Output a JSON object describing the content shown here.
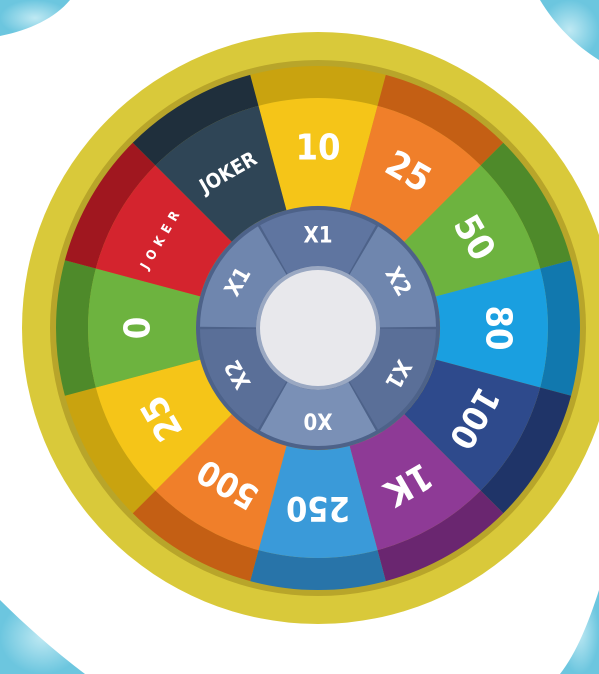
{
  "wheel": {
    "outer_segments": [
      {
        "label": "10",
        "color": "#f5c518",
        "rim": "#c9a30f"
      },
      {
        "label": "25",
        "color": "#f07f2a",
        "rim": "#c45f14"
      },
      {
        "label": "50",
        "color": "#6db33f",
        "rim": "#4e8a2a"
      },
      {
        "label": "80",
        "color": "#1a9fe0",
        "rim": "#1178ae"
      },
      {
        "label": "100",
        "color": "#2e4a8c",
        "rim": "#1f3468"
      },
      {
        "label": "1K",
        "color": "#8e3a96",
        "rim": "#6a2670"
      },
      {
        "label": "250",
        "color": "#3a9ad9",
        "rim": "#2874a9"
      },
      {
        "label": "500",
        "color": "#f07f2a",
        "rim": "#c45f14"
      },
      {
        "label": "25",
        "color": "#f5c518",
        "rim": "#c9a30f"
      },
      {
        "label": "0",
        "color": "#6db33f",
        "rim": "#4e8a2a"
      },
      {
        "label": "JOKER",
        "color": "#d4242e",
        "rim": "#a0171f"
      },
      {
        "label": "JOKER",
        "color": "#2f4556",
        "rim": "#1f2f3c"
      }
    ],
    "inner_multipliers": [
      {
        "label": "X1",
        "color": "#5f75a0"
      },
      {
        "label": "X2",
        "color": "#6f86ae"
      },
      {
        "label": "X1",
        "color": "#5a6f98"
      },
      {
        "label": "X0",
        "color": "#7a90b6"
      },
      {
        "label": "X2",
        "color": "#5a6f98"
      },
      {
        "label": "X1",
        "color": "#6f86ae"
      }
    ],
    "colors": {
      "frame": "#d9c93a",
      "frame_dark": "#b8a52a",
      "hub": "#e8e8ec",
      "background_blob": "#7fd0e3"
    }
  }
}
